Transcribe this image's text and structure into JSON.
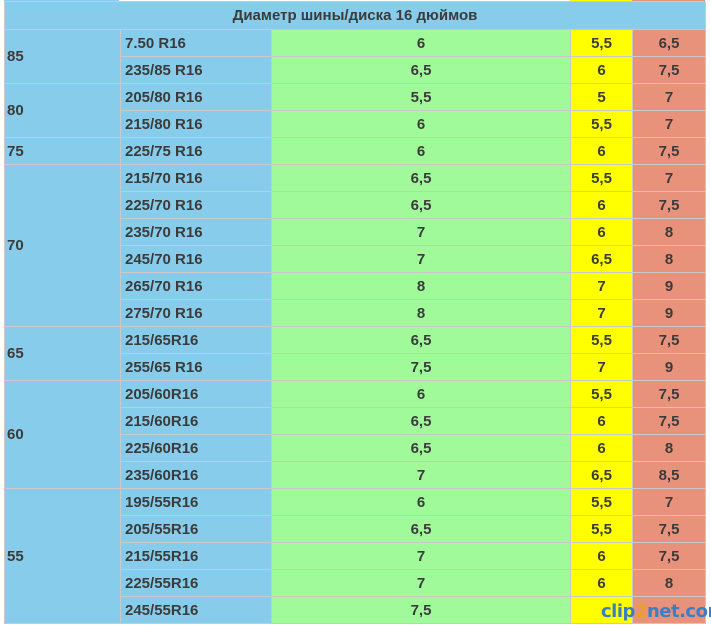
{
  "header": {
    "title": "Диаметр шины/диска 16 дюймов"
  },
  "colors": {
    "profile_bg": "#87cdeb",
    "width_bg": "#a0fa9a",
    "min_bg": "#ffff00",
    "max_bg": "#e8927c"
  },
  "groups": [
    {
      "profile": "85",
      "rows": [
        {
          "size": "7.50 R16",
          "width": "6",
          "min": "5,5",
          "max": "6,5"
        },
        {
          "size": "235/85 R16",
          "width": "6,5",
          "min": "6",
          "max": "7,5"
        }
      ]
    },
    {
      "profile": "80",
      "rows": [
        {
          "size": "205/80 R16",
          "width": "5,5",
          "min": "5",
          "max": "7"
        },
        {
          "size": "215/80 R16",
          "width": "6",
          "min": "5,5",
          "max": "7"
        }
      ]
    },
    {
      "profile": "75",
      "rows": [
        {
          "size": "225/75 R16",
          "width": "6",
          "min": "6",
          "max": "7,5"
        }
      ]
    },
    {
      "profile": "70",
      "rows": [
        {
          "size": "215/70 R16",
          "width": "6,5",
          "min": "5,5",
          "max": "7"
        },
        {
          "size": "225/70 R16",
          "width": "6,5",
          "min": "6",
          "max": "7,5"
        },
        {
          "size": "235/70 R16",
          "width": "7",
          "min": "6",
          "max": "8"
        },
        {
          "size": "245/70 R16",
          "width": "7",
          "min": "6,5",
          "max": "8"
        },
        {
          "size": "265/70 R16",
          "width": "8",
          "min": "7",
          "max": "9"
        },
        {
          "size": "275/70 R16",
          "width": "8",
          "min": "7",
          "max": "9"
        }
      ]
    },
    {
      "profile": "65",
      "rows": [
        {
          "size": "215/65R16",
          "width": "6,5",
          "min": "5,5",
          "max": "7,5"
        },
        {
          "size": "255/65 R16",
          "width": "7,5",
          "min": "7",
          "max": "9"
        }
      ]
    },
    {
      "profile": "60",
      "rows": [
        {
          "size": "205/60R16",
          "width": "6",
          "min": "5,5",
          "max": "7,5"
        },
        {
          "size": "215/60R16",
          "width": "6,5",
          "min": "6",
          "max": "7,5"
        },
        {
          "size": "225/60R16",
          "width": "6,5",
          "min": "6",
          "max": "8"
        },
        {
          "size": "235/60R16",
          "width": "7",
          "min": "6,5",
          "max": "8,5"
        }
      ]
    },
    {
      "profile": "55",
      "rows": [
        {
          "size": "195/55R16",
          "width": "6",
          "min": "5,5",
          "max": "7"
        },
        {
          "size": "205/55R16",
          "width": "6,5",
          "min": "5,5",
          "max": "7,5"
        },
        {
          "size": "215/55R16",
          "width": "7",
          "min": "6",
          "max": "7,5"
        },
        {
          "size": "225/55R16",
          "width": "7",
          "min": "6",
          "max": "8"
        },
        {
          "size": "245/55R16",
          "width": "7,5",
          "min": "",
          "max": ""
        }
      ]
    }
  ],
  "watermark": {
    "part1": "clip",
    "part2": "2",
    "part3": "net.com"
  }
}
